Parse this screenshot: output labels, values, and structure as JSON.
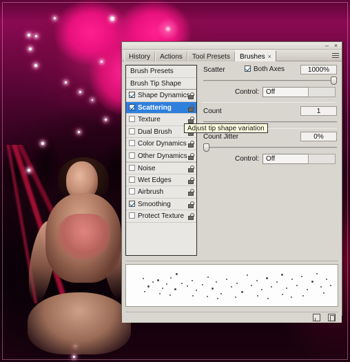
{
  "window": {
    "minimize_label": "–",
    "close_label": "×",
    "menu_icon": "panel-menu-icon"
  },
  "tabs": [
    {
      "label": "History",
      "active": false
    },
    {
      "label": "Actions",
      "active": false
    },
    {
      "label": "Tool Presets",
      "active": false
    },
    {
      "label": "Brushes",
      "active": true,
      "close_label": "×"
    }
  ],
  "options_list": [
    {
      "label": "Brush Presets",
      "type": "header",
      "checkbox": null,
      "lock": false,
      "selected": false
    },
    {
      "label": "Brush Tip Shape",
      "type": "header",
      "checkbox": null,
      "lock": false,
      "selected": false
    },
    {
      "label": "Shape Dynamics",
      "type": "option",
      "checkbox": true,
      "lock": true,
      "selected": false
    },
    {
      "label": "Scattering",
      "type": "option",
      "checkbox": true,
      "lock": true,
      "selected": true
    },
    {
      "label": "Texture",
      "type": "option",
      "checkbox": false,
      "lock": true,
      "selected": false
    },
    {
      "label": "Dual Brush",
      "type": "option",
      "checkbox": false,
      "lock": true,
      "selected": false
    },
    {
      "label": "Color Dynamics",
      "type": "option",
      "checkbox": false,
      "lock": true,
      "selected": false
    },
    {
      "label": "Other Dynamics",
      "type": "option",
      "checkbox": false,
      "lock": true,
      "selected": false
    },
    {
      "label": "Noise",
      "type": "option",
      "checkbox": false,
      "lock": true,
      "selected": false
    },
    {
      "label": "Wet Edges",
      "type": "option",
      "checkbox": false,
      "lock": true,
      "selected": false
    },
    {
      "label": "Airbrush",
      "type": "option",
      "checkbox": false,
      "lock": true,
      "selected": false
    },
    {
      "label": "Smoothing",
      "type": "option",
      "checkbox": true,
      "lock": true,
      "selected": false
    },
    {
      "label": "Protect Texture",
      "type": "option",
      "checkbox": false,
      "lock": true,
      "selected": false
    }
  ],
  "controls": {
    "scatter": {
      "label": "Scatter",
      "both_axes_label": "Both Axes",
      "both_axes_checked": true,
      "value": "1000%",
      "slider_percent": 100,
      "control_label": "Control:",
      "control_value": "Off"
    },
    "count": {
      "label": "Count",
      "value": "1"
    },
    "count_jitter": {
      "label": "Count Jitter",
      "value": "0%",
      "slider_percent": 0,
      "control_label": "Control:",
      "control_value": "Off"
    }
  },
  "tooltip": {
    "text": "Adjust tip shape variation"
  },
  "footer": {
    "new_brush_icon": "new-brush-icon",
    "delete_brush_icon": "trash-icon"
  },
  "preview": {
    "label": "brush-stroke-preview"
  },
  "colors": {
    "selection_blue": "#2f7fdd",
    "panel_bg": "#d9d6d0",
    "tooltip_bg": "#ffffe1",
    "artwork_magenta": "#ff1f8f"
  }
}
